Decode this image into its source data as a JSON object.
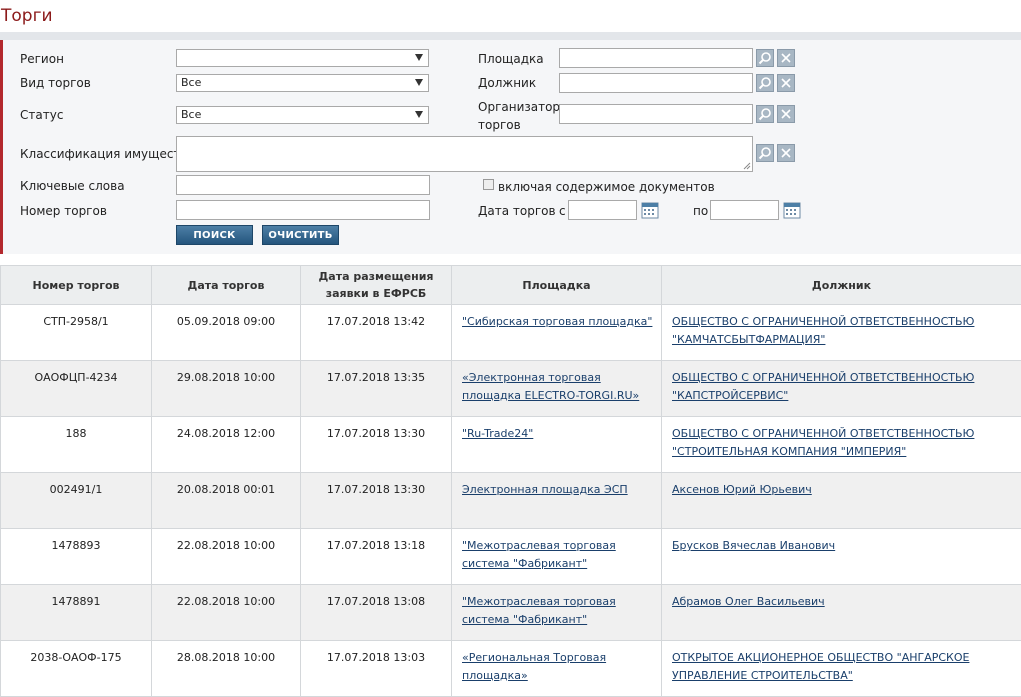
{
  "page_title": "Торги",
  "filters": {
    "region_label": "Регион",
    "region_value": "",
    "type_label": "Вид торгов",
    "type_value": "Все",
    "status_label": "Статус",
    "status_value": "Все",
    "platform_label": "Площадка",
    "debtor_label": "Должник",
    "organizer_label_1": "Организатор",
    "organizer_label_2": "торгов",
    "classification_label": "Классификация имущества",
    "keywords_label": "Ключевые слова",
    "include_docs_label": "включая содержимое документов",
    "number_label": "Номер торгов",
    "date_label": "Дата торгов",
    "date_from_label": "с",
    "date_to_label": "по",
    "search_button": "ПОИСК",
    "clear_button": "ОЧИСТИТЬ"
  },
  "table": {
    "headers": [
      "Номер торгов",
      "Дата торгов",
      "Дата размещения заявки в ЕФРСБ",
      "Площадка",
      "Должник"
    ],
    "rows": [
      {
        "number": "СТП-2958/1",
        "date": "05.09.2018 09:00",
        "posted": "17.07.2018 13:42",
        "platform": "\"Сибирская торговая площадка\"",
        "debtor": "ОБЩЕСТВО С ОГРАНИЧЕННОЙ ОТВЕТСТВЕННОСТЬЮ \"КАМЧАТСБЫТФАРМАЦИЯ\""
      },
      {
        "number": "ОАОФЦП-4234",
        "date": "29.08.2018 10:00",
        "posted": "17.07.2018 13:35",
        "platform": "«Электронная торговая площадка ELECTRO-TORGI.RU»",
        "debtor": "ОБЩЕСТВО С ОГРАНИЧЕННОЙ ОТВЕТСТВЕННОСТЬЮ \"КАПСТРОЙСЕРВИС\""
      },
      {
        "number": "188",
        "date": "24.08.2018 12:00",
        "posted": "17.07.2018 13:30",
        "platform": "\"Ru-Trade24\"",
        "debtor": "ОБЩЕСТВО С ОГРАНИЧЕННОЙ ОТВЕТСТВЕННОСТЬЮ \"СТРОИТЕЛЬНАЯ КОМПАНИЯ \"ИМПЕРИЯ\""
      },
      {
        "number": "002491/1",
        "date": "20.08.2018 00:01",
        "posted": "17.07.2018 13:30",
        "platform": "Электронная площадка ЭСП",
        "debtor": "Аксенов Юрий Юрьевич"
      },
      {
        "number": "1478893",
        "date": "22.08.2018 10:00",
        "posted": "17.07.2018 13:18",
        "platform": "\"Межотраслевая торговая система \"Фабрикант\"",
        "debtor": "Брусков Вячеслав Иванович"
      },
      {
        "number": "1478891",
        "date": "22.08.2018 10:00",
        "posted": "17.07.2018 13:08",
        "platform": "\"Межотраслевая торговая система \"Фабрикант\"",
        "debtor": "Абрамов Олег Васильевич"
      },
      {
        "number": "2038-ОАОФ-175",
        "date": "28.08.2018 10:00",
        "posted": "17.07.2018 13:03",
        "platform": "«Региональная Торговая площадка»",
        "debtor": "ОТКРЫТОЕ АКЦИОНЕРНОЕ ОБЩЕСТВО \"АНГАРСКОЕ УПРАВЛЕНИЕ СТРОИТЕЛЬСТВА\""
      }
    ]
  }
}
